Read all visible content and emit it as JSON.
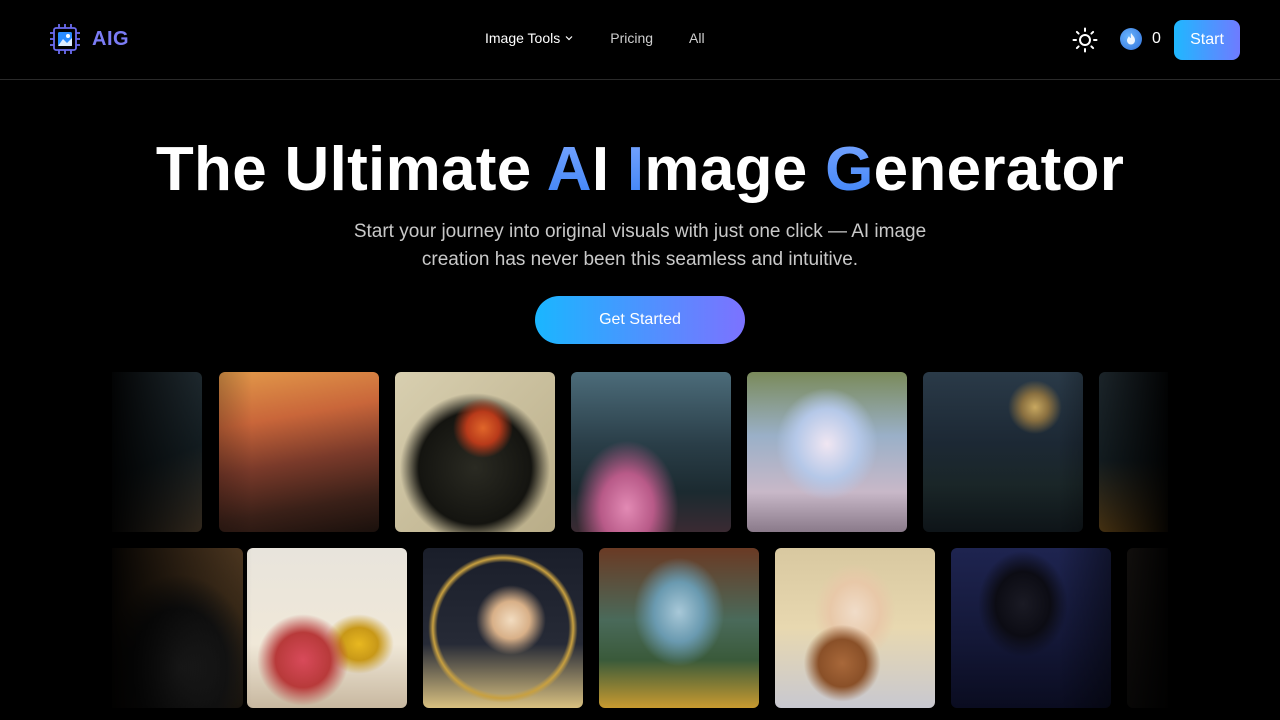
{
  "nav": {
    "logo_text": "AIG",
    "links": [
      {
        "label": "Image Tools"
      },
      {
        "label": "Pricing"
      },
      {
        "label": "All"
      }
    ],
    "credits": "0",
    "start_label": "Start"
  },
  "hero": {
    "title_parts": [
      "The Ultimate ",
      "A",
      "I ",
      "I",
      "mage ",
      "G",
      "enerator"
    ],
    "subtitle": "Start your journey into original visuals with just one click — AI image creation has never been this seamless and intuitive.",
    "cta_label": "Get Started"
  },
  "gallery": {
    "row1": [
      "street-image",
      "sunset-street-image",
      "cyber-soldier-image",
      "pagoda-city-image",
      "elf-girl-image",
      "castle-lake-image",
      "night-scene-image"
    ],
    "row2": [
      "car-image",
      "excavator-fruit-image",
      "hooded-woman-image",
      "canyon-image",
      "donut-girl-image",
      "dark-figure-image",
      "dark-image"
    ]
  },
  "colors": {
    "accent_start": "#1ab6ff",
    "accent_end": "#7c72ff",
    "logo": "#7b7cf5"
  }
}
